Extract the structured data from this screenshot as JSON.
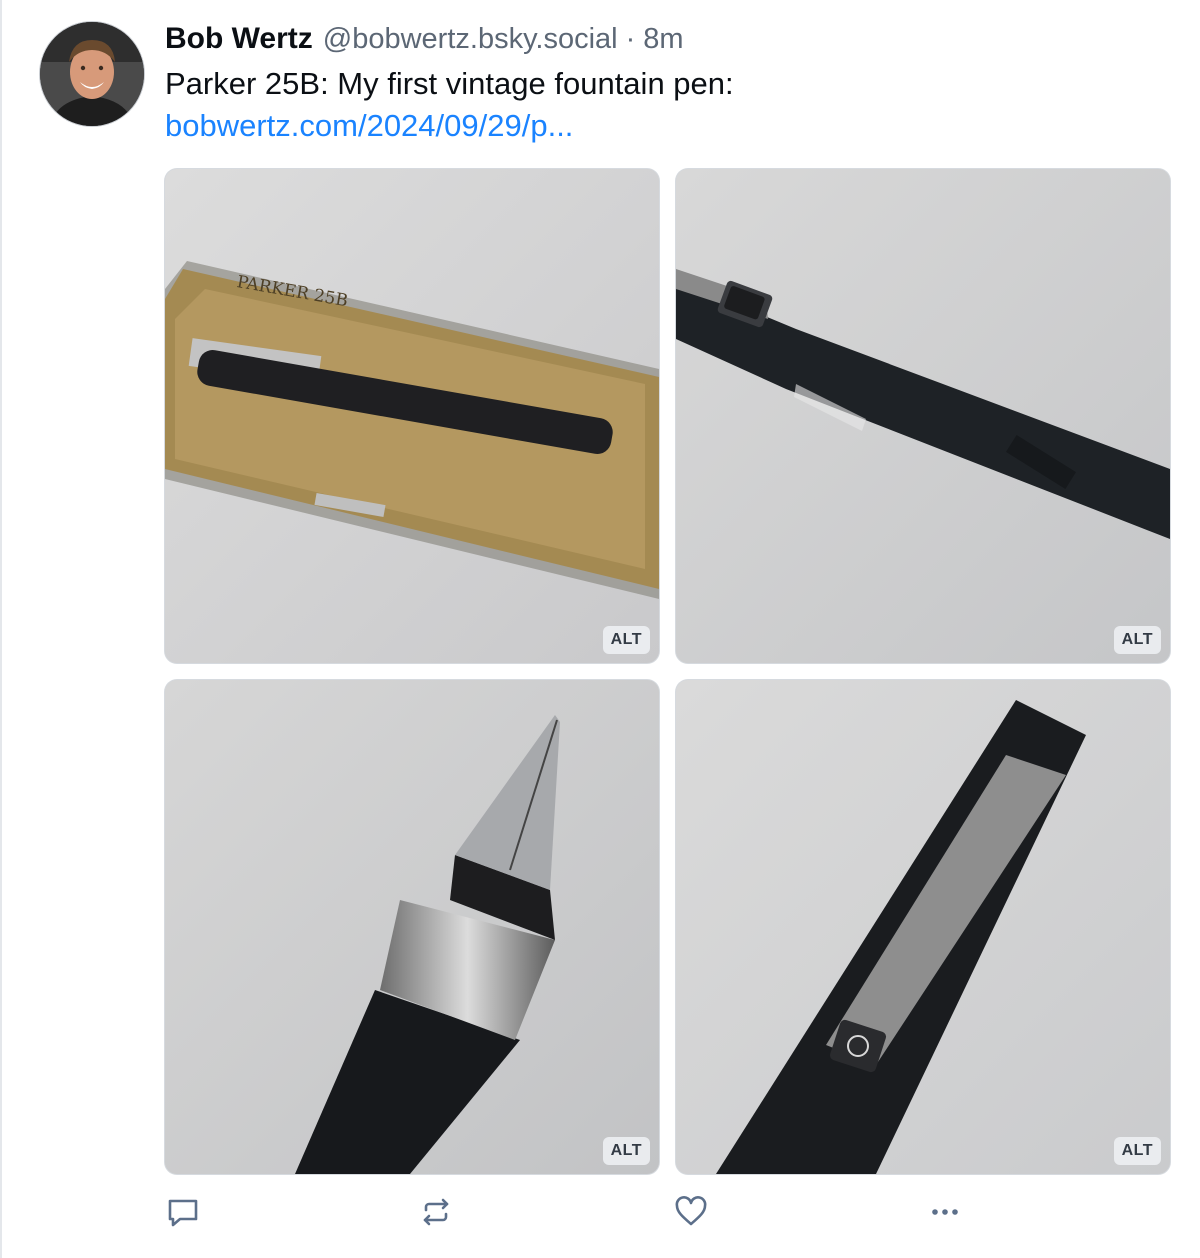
{
  "post": {
    "author": {
      "display_name": "Bob Wertz",
      "handle": "@bobwertz.bsky.social"
    },
    "separator": "·",
    "time_ago": "8m",
    "text": "Parker 25B: My first vintage fountain pen:",
    "link_text": "bobwertz.com/2024/09/29/p..."
  },
  "images": [
    {
      "alt_label": "ALT",
      "box_label": "PARKER 25B"
    },
    {
      "alt_label": "ALT"
    },
    {
      "alt_label": "ALT"
    },
    {
      "alt_label": "ALT"
    }
  ],
  "actions": [
    {
      "icon": "reply-icon"
    },
    {
      "icon": "repost-icon"
    },
    {
      "icon": "heart-icon"
    },
    {
      "icon": "more-icon"
    }
  ],
  "colors": {
    "link": "#1a83ff",
    "secondary_text": "#5c6775",
    "primary_text": "#0b0f14",
    "icon": "#5c6f8a"
  }
}
